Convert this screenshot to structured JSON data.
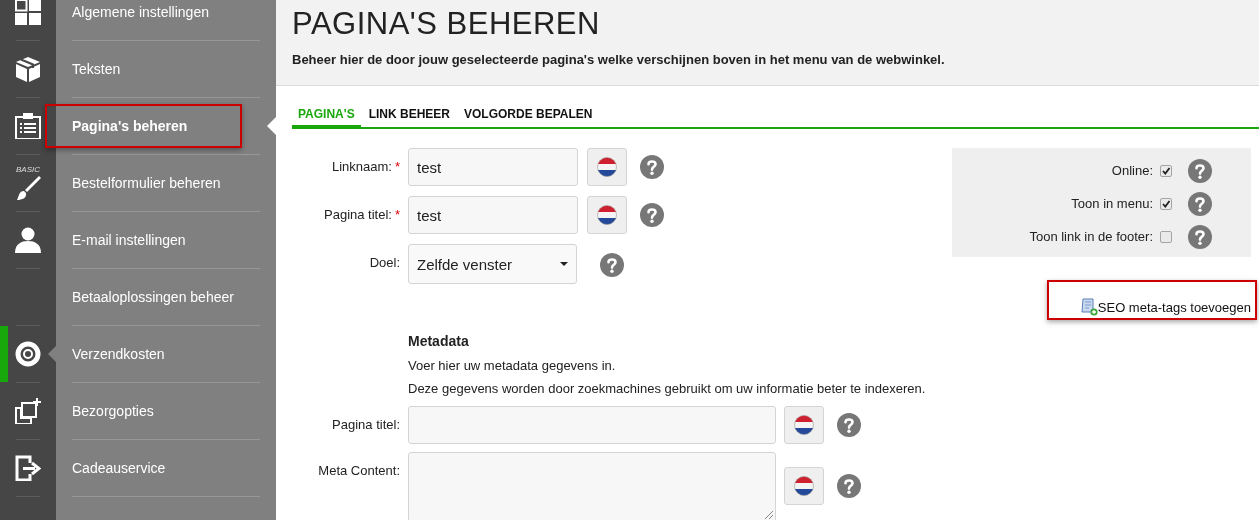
{
  "rail": {
    "items": [
      {
        "kind": "icon",
        "selected": false
      },
      {
        "kind": "icon",
        "selected": false
      },
      {
        "kind": "icon",
        "selected": false
      },
      {
        "kind": "icon",
        "badge": "BASIC",
        "selected": false
      },
      {
        "kind": "icon",
        "selected": false
      },
      {
        "kind": "empty"
      },
      {
        "kind": "icon",
        "selected": true
      },
      {
        "kind": "icon",
        "selected": false
      },
      {
        "kind": "icon",
        "selected": false
      }
    ]
  },
  "menu": {
    "items": [
      {
        "label": "Algemene instellingen",
        "selected": false,
        "highlighted": false
      },
      {
        "label": "Teksten",
        "selected": false,
        "highlighted": false
      },
      {
        "label": "Pagina's beheren",
        "selected": true,
        "highlighted": true
      },
      {
        "label": "Bestelformulier beheren",
        "selected": false,
        "highlighted": false
      },
      {
        "label": "E-mail instellingen",
        "selected": false,
        "highlighted": false
      },
      {
        "label": "Betaaloplossingen beheer",
        "selected": false,
        "highlighted": false
      },
      {
        "label": "Verzendkosten",
        "selected": false,
        "highlighted": false
      },
      {
        "label": "Bezorgopties",
        "selected": false,
        "highlighted": false
      },
      {
        "label": "Cadeauservice",
        "selected": false,
        "highlighted": false
      }
    ]
  },
  "header": {
    "title": "PAGINA'S BEHEREN",
    "subtitle": "Beheer hier de door jouw geselecteerde pagina's welke verschijnen boven in het menu van de webwinkel."
  },
  "tabs": [
    {
      "label": "PAGINA'S",
      "selected": true
    },
    {
      "label": "LINK BEHEER",
      "selected": false
    },
    {
      "label": "VOLGORDE BEPALEN",
      "selected": false
    }
  ],
  "form": {
    "fields": [
      {
        "label": "Linknaam:",
        "required_mark": "*",
        "kind": "text",
        "value": "test",
        "translatable": true
      },
      {
        "label": "Pagina titel:",
        "required_mark": "*",
        "kind": "text",
        "value": "test",
        "translatable": true
      },
      {
        "label": "Doel:",
        "kind": "select",
        "value": "Zelfde venster",
        "translatable": false
      }
    ]
  },
  "options": [
    {
      "label": "Online:",
      "checked": true
    },
    {
      "label": "Toon in menu:",
      "checked": true
    },
    {
      "label": "Toon link in de footer:",
      "checked": false
    }
  ],
  "seo_link": {
    "label": "SEO meta-tags toevoegen",
    "highlighted": true
  },
  "metadata": {
    "title": "Metadata",
    "lines": [
      "Voer hier uw metadata gegevens in.",
      "Deze gegevens worden door zoekmachines gebruikt om uw informatie beter te indexeren."
    ],
    "fields": [
      {
        "label": "Pagina titel:",
        "kind": "text",
        "translatable": true
      },
      {
        "label": "Meta Content:",
        "kind": "textarea",
        "translatable": true
      }
    ]
  }
}
